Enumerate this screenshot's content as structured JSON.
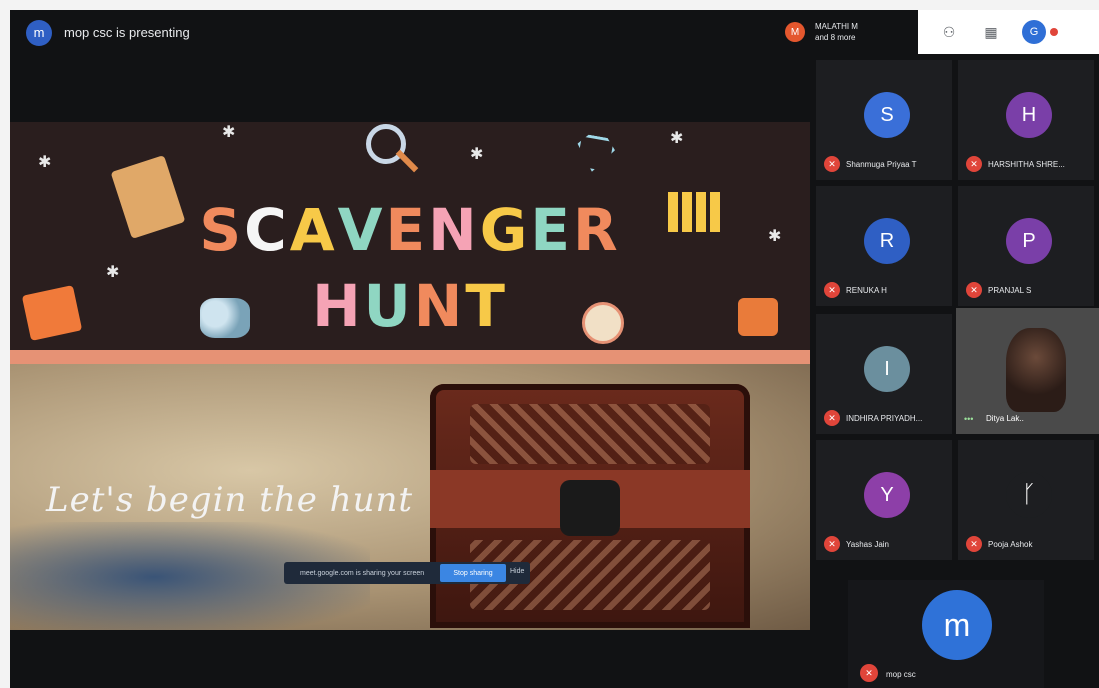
{
  "presenter": {
    "avatar_letter": "m",
    "label": "mop csc is presenting"
  },
  "top_participant": {
    "badge": "M",
    "name_line1": "MALATHI M",
    "name_line2": "and 8 more"
  },
  "toolbar": {
    "account_letter": "G"
  },
  "slide": {
    "title_word1": "SCAVENGER",
    "title_word2": "HUNT",
    "subtitle": "Let's begin the hunt",
    "title_colors": [
      "#f08a5d",
      "#f5f5f5",
      "#f7c948",
      "#8fd6c2",
      "#f08a5d",
      "#f5a3b5",
      "#f7c948",
      "#8fd6c2",
      "#f08a5d"
    ],
    "title2_colors": [
      "#f5a3b5",
      "#8fd6c2",
      "#f08a5d",
      "#f7c948"
    ]
  },
  "share_bar": {
    "text": "meet.google.com is sharing your screen",
    "button": "Stop sharing",
    "hide": "Hide"
  },
  "participants": [
    {
      "letter": "S",
      "name": "Shanmuga Priyaa T",
      "color": "#3a6fd8"
    },
    {
      "letter": "H",
      "name": "HARSHITHA SHRE...",
      "color": "#7a3fa8"
    },
    {
      "letter": "R",
      "name": "RENUKA H",
      "color": "#2f5fc4"
    },
    {
      "letter": "P",
      "name": "PRANJAL S",
      "color": "#7a3fa8"
    },
    {
      "letter": "I",
      "name": "INDHIRA PRIYADH...",
      "color": "#6b8f9e"
    },
    {
      "letter": "",
      "name": "Ditya Lak..",
      "color": ""
    },
    {
      "letter": "Y",
      "name": "Yashas Jain",
      "color": "#8d3fa8"
    },
    {
      "letter": "",
      "name": "Pooja Ashok",
      "color": ""
    }
  ],
  "self_tile": {
    "letter": "m",
    "name": "mop csc"
  }
}
